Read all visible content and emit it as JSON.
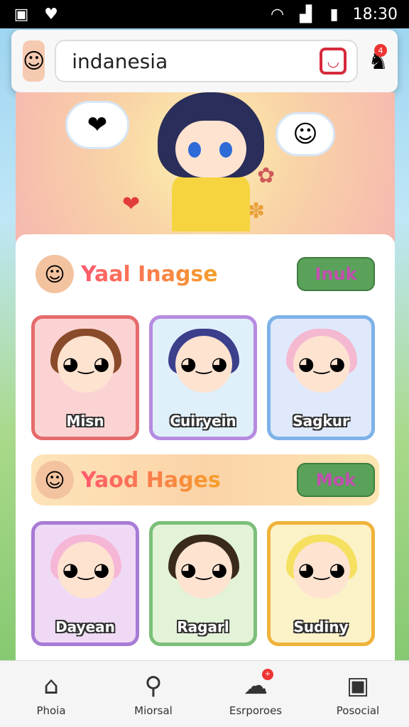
{
  "status_bar": {
    "time": "18:30",
    "icons": [
      "app-icon",
      "heart-icon",
      "wifi-icon",
      "signal-icon",
      "battery-icon"
    ]
  },
  "header": {
    "search_value": "indanesia",
    "notification_badge": "4"
  },
  "sections": [
    {
      "title": "Yaal Inagse",
      "button_label": "Inuk",
      "cards": [
        {
          "name": "Misn",
          "border": "#e66b6b",
          "bg": "#fbd3d3",
          "hair": "#8a4b2a"
        },
        {
          "name": "Cuiryein",
          "border": "#b68be0",
          "bg": "#dff0fb",
          "hair": "#3b3f8c"
        },
        {
          "name": "Sagkur",
          "border": "#7eb2e8",
          "bg": "#dfe9fb",
          "hair": "#f4b8d0"
        }
      ]
    },
    {
      "title": "Yaod Hages",
      "button_label": "Mok",
      "cards": [
        {
          "name": "Dayean",
          "border": "#a77bd6",
          "bg": "#efd9f5",
          "hair": "#f6b6d6"
        },
        {
          "name": "Ragarl",
          "border": "#7cbf7a",
          "bg": "#e2f3d7",
          "hair": "#3a2a1c"
        },
        {
          "name": "Sudiny",
          "border": "#f0b23a",
          "bg": "#fcf2c8",
          "hair": "#f5e060"
        }
      ]
    }
  ],
  "bottom_nav": [
    {
      "label": "Phoia",
      "icon": "home-icon"
    },
    {
      "label": "Miorsal",
      "icon": "search-icon"
    },
    {
      "label": "Esrporoes",
      "icon": "chat-icon",
      "badge": "+"
    },
    {
      "label": "Posocial",
      "icon": "profile-icon"
    }
  ]
}
